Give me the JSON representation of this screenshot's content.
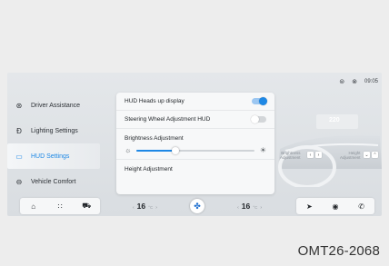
{
  "status": {
    "icon1": "hud-icon",
    "icon2": "signal-icon",
    "time": "09:05"
  },
  "sidebar": {
    "items": [
      {
        "label": "Driver Assistance",
        "icon": "steering-icon"
      },
      {
        "label": "Lighting Settings",
        "icon": "headlight-icon"
      },
      {
        "label": "HUD Settings",
        "icon": "hud-icon",
        "active": true
      },
      {
        "label": "Vehicle Comfort",
        "icon": "comfort-icon"
      }
    ]
  },
  "panel": {
    "hud_label": "HUD Heads up display",
    "hud_on": true,
    "steering_label": "Steering Wheel Adjustment HUD",
    "steering_on": false,
    "brightness_label": "Brightness Adjustment",
    "brightness_value": 0.33,
    "height_label": "Height Adjustment"
  },
  "preview": {
    "brightness_line1": "Brightness",
    "brightness_line2": "Adjustment",
    "height_line1": "Height",
    "height_line2": "Adjustment",
    "hud_readout": "220"
  },
  "dock": {
    "left_icons": [
      "home-icon",
      "apps-icon",
      "car-icon"
    ],
    "right_icons": [
      "navigation-icon",
      "music-icon",
      "phone-icon"
    ],
    "temp_left": "16",
    "temp_right": "16",
    "deg": "°C"
  },
  "caption": "OMT26-2068",
  "colors": {
    "accent": "#1e88e5"
  }
}
